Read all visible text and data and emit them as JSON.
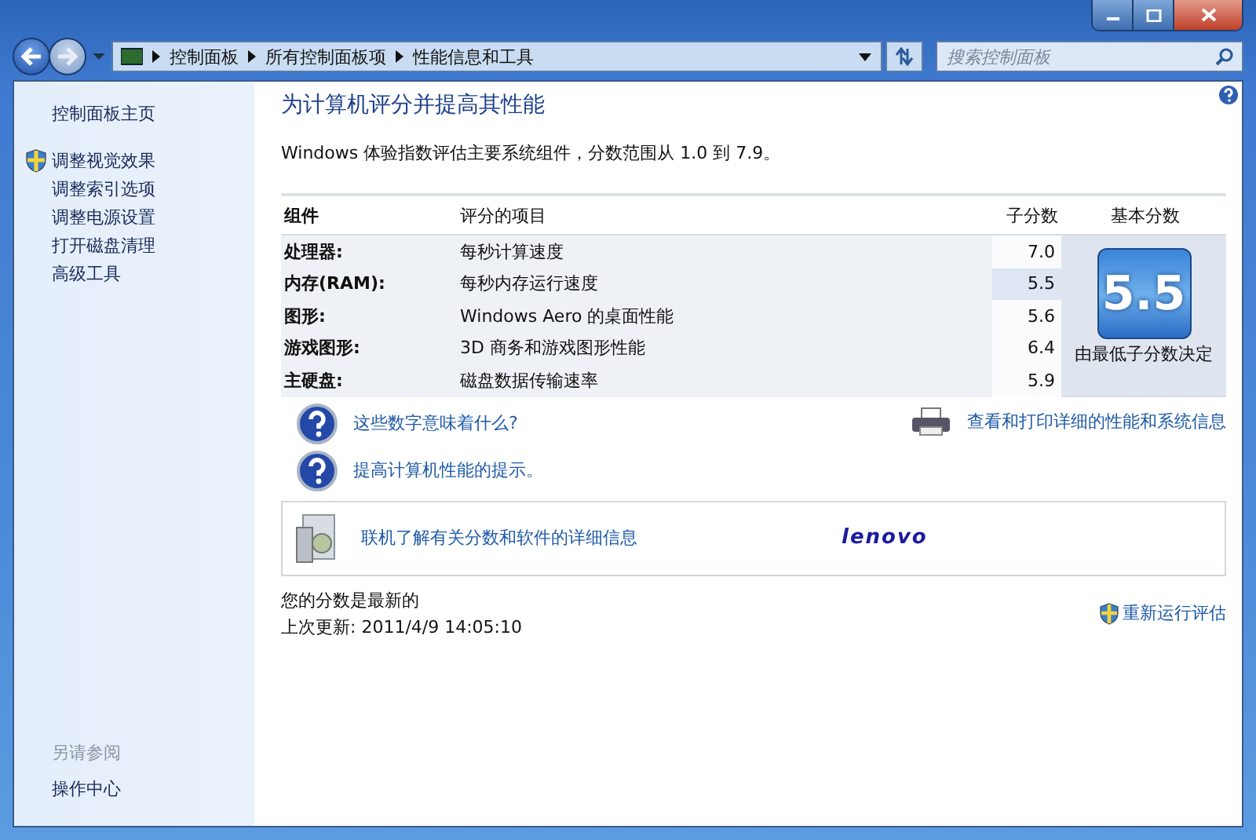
{
  "address_bar": {
    "breadcrumbs": [
      "控制面板",
      "所有控制面板项",
      "性能信息和工具"
    ]
  },
  "search": {
    "placeholder": "搜索控制面板"
  },
  "sidebar": {
    "items": [
      {
        "label": "控制面板主页",
        "shield": false
      },
      {
        "label": "调整视觉效果",
        "shield": true
      },
      {
        "label": "调整索引选项",
        "shield": false
      },
      {
        "label": "调整电源设置",
        "shield": false
      },
      {
        "label": "打开磁盘清理",
        "shield": false
      },
      {
        "label": "高级工具",
        "shield": false
      }
    ],
    "see_also": {
      "heading": "另请参阅",
      "items": [
        "操作中心"
      ]
    }
  },
  "title": "为计算机评分并提高其性能",
  "description": "Windows 体验指数评估主要系统组件，分数范围从 1.0 到 7.9。",
  "table": {
    "columns": [
      "组件",
      "评分的项目",
      "子分数",
      "基本分数"
    ],
    "rows": [
      {
        "component": "处理器:",
        "item": "每秒计算速度",
        "subscore": "7.0",
        "lowest": false
      },
      {
        "component": "内存(RAM):",
        "item": "每秒内存运行速度",
        "subscore": "5.5",
        "lowest": true
      },
      {
        "component": "图形:",
        "item": "Windows Aero 的桌面性能",
        "subscore": "5.6",
        "lowest": false
      },
      {
        "component": "游戏图形:",
        "item": "3D 商务和游戏图形性能",
        "subscore": "6.4",
        "lowest": false
      },
      {
        "component": "主硬盘:",
        "item": "磁盘数据传输速率",
        "subscore": "5.9",
        "lowest": false
      }
    ],
    "base_score": {
      "value": "5.5",
      "caption": "由最低子分数决定"
    }
  },
  "help_links": [
    "这些数字意味着什么?",
    "提高计算机性能的提示。"
  ],
  "print_link": "查看和打印详细的性能和系统信息",
  "online": {
    "label": "联机了解有关分数和软件的详细信息",
    "logo": "lenovo"
  },
  "status": {
    "current": "您的分数是最新的",
    "last_update": "上次更新: 2011/4/9 14:05:10"
  },
  "rerun": "重新运行评估"
}
